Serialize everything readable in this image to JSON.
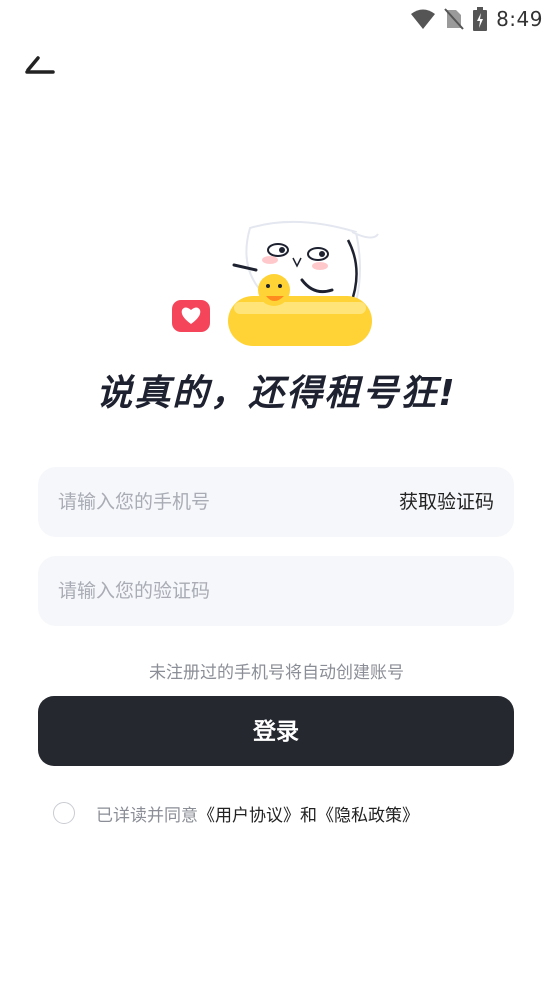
{
  "status_bar": {
    "time": "8:49",
    "icons": [
      "wifi-icon",
      "no-sim-icon",
      "battery-charging-icon"
    ]
  },
  "nav": {
    "back_icon": "back-arrow-icon"
  },
  "illustration": {
    "icons": [
      "mascot-illustration",
      "duck-icon",
      "heart-badge-icon"
    ]
  },
  "slogan": "说真的，还得租号狂!",
  "form": {
    "phone_placeholder": "请输入您的手机号",
    "get_code_label": "获取验证码",
    "code_placeholder": "请输入您的验证码",
    "hint": "未注册过的手机号将自动创建账号",
    "login_label": "登录"
  },
  "agreement": {
    "prefix": "已详读并同意",
    "user_agreement": "《用户协议》",
    "conjunction": "和",
    "privacy_policy": "《隐私政策》"
  },
  "colors": {
    "primary_dark": "#262830",
    "field_bg": "#f6f7fa",
    "placeholder": "#a9acb5",
    "hint_text": "#8b8e96",
    "duck_yellow": "#ffd335",
    "heart_red": "#f5455b"
  }
}
